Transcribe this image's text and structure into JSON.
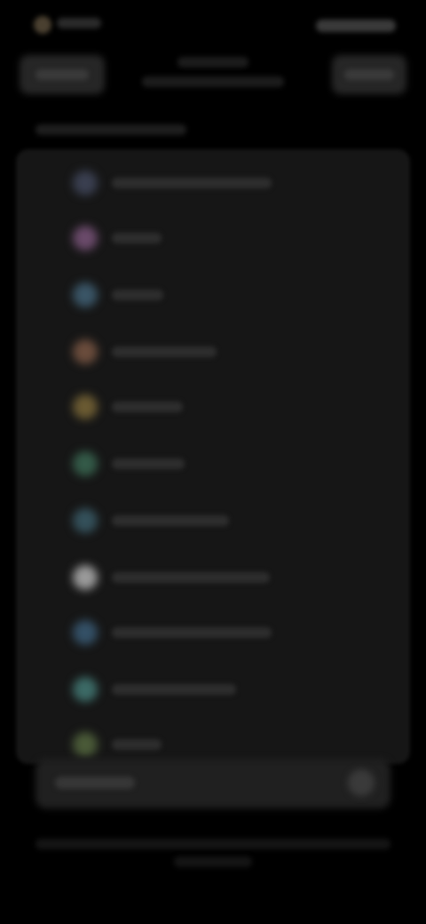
{
  "status_bar": {
    "time": "",
    "icons": ""
  },
  "nav": {
    "left_button_label": "",
    "title": "",
    "subtitle": "",
    "right_button_label": ""
  },
  "section": {
    "header": ""
  },
  "list": {
    "items": [
      {
        "label": "",
        "icon": "circle-icon",
        "color": "#3a3f50"
      },
      {
        "label": "",
        "icon": "circle-icon",
        "color": "#6a4a6a"
      },
      {
        "label": "",
        "icon": "circle-icon",
        "color": "#3a5566"
      },
      {
        "label": "",
        "icon": "circle-icon",
        "color": "#6a4c3c"
      },
      {
        "label": "",
        "icon": "circle-icon",
        "color": "#6a5a32"
      },
      {
        "label": "",
        "icon": "circle-icon",
        "color": "#345a48"
      },
      {
        "label": "",
        "icon": "circle-icon",
        "color": "#34505a"
      },
      {
        "label": "",
        "icon": "circle-icon",
        "color": "#9a9a9a"
      },
      {
        "label": "",
        "icon": "circle-icon",
        "color": "#345066"
      },
      {
        "label": "",
        "icon": "circle-icon",
        "color": "#3c6a66"
      },
      {
        "label": "",
        "icon": "circle-icon",
        "color": "#4a5a38"
      }
    ]
  },
  "bottom_bar": {
    "label": "",
    "icon": "plus-icon"
  },
  "footer": {
    "text": ""
  }
}
